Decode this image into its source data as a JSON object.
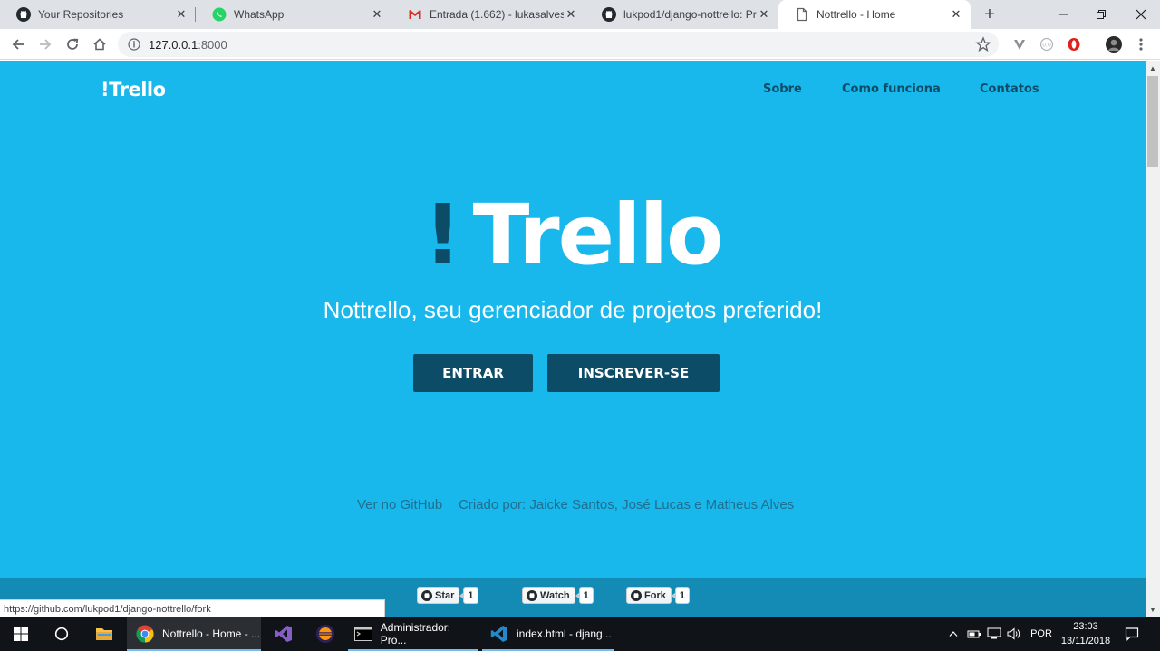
{
  "browser": {
    "tabs": [
      {
        "title": "Your Repositories",
        "icon": "github-icon",
        "active": false
      },
      {
        "title": "WhatsApp",
        "icon": "whatsapp-icon",
        "active": false
      },
      {
        "title": "Entrada (1.662) - lukasalvespor",
        "icon": "gmail-icon",
        "active": false
      },
      {
        "title": "lukpod1/django-nottrello: Proj",
        "icon": "github-icon",
        "active": false
      },
      {
        "title": "Nottrello - Home",
        "icon": "page-icon",
        "active": true
      }
    ],
    "address": {
      "host": "127.0.0.1",
      "port": ":8000"
    },
    "status_url": "https://github.com/lukpod1/django-nottrello/fork"
  },
  "site": {
    "brand": "!Trello",
    "nav": [
      "Sobre",
      "Como funciona",
      "Contatos"
    ],
    "hero": {
      "bang": "!",
      "word": "Trello"
    },
    "subtitle": "Nottrello, seu gerenciador de projetos preferido!",
    "buttons": {
      "login": "ENTRAR",
      "signup": "INSCREVER-SE"
    },
    "footer": {
      "github_link": "Ver no GitHub",
      "credits": "Criado por: Jaicke Santos, José Lucas e Matheus Alves"
    },
    "github_buttons": [
      {
        "label": "Star",
        "count": "1"
      },
      {
        "label": "Watch",
        "count": "1"
      },
      {
        "label": "Fork",
        "count": "1"
      }
    ],
    "colors": {
      "background": "#18b7ec",
      "accent": "#0d4c66"
    }
  },
  "taskbar": {
    "apps": [
      {
        "label": "Nottrello - Home - ...",
        "icon": "chrome-icon",
        "active": true
      },
      {
        "label": "",
        "icon": "visual-studio-icon",
        "active": false
      },
      {
        "label": "",
        "icon": "eclipse-icon",
        "active": false
      },
      {
        "label": "Administrador: Pro...",
        "icon": "cmd-icon",
        "active": false
      },
      {
        "label": "index.html - djang...",
        "icon": "vscode-icon",
        "active": false
      }
    ],
    "language": "POR",
    "time": "23:03",
    "date": "13/11/2018"
  }
}
